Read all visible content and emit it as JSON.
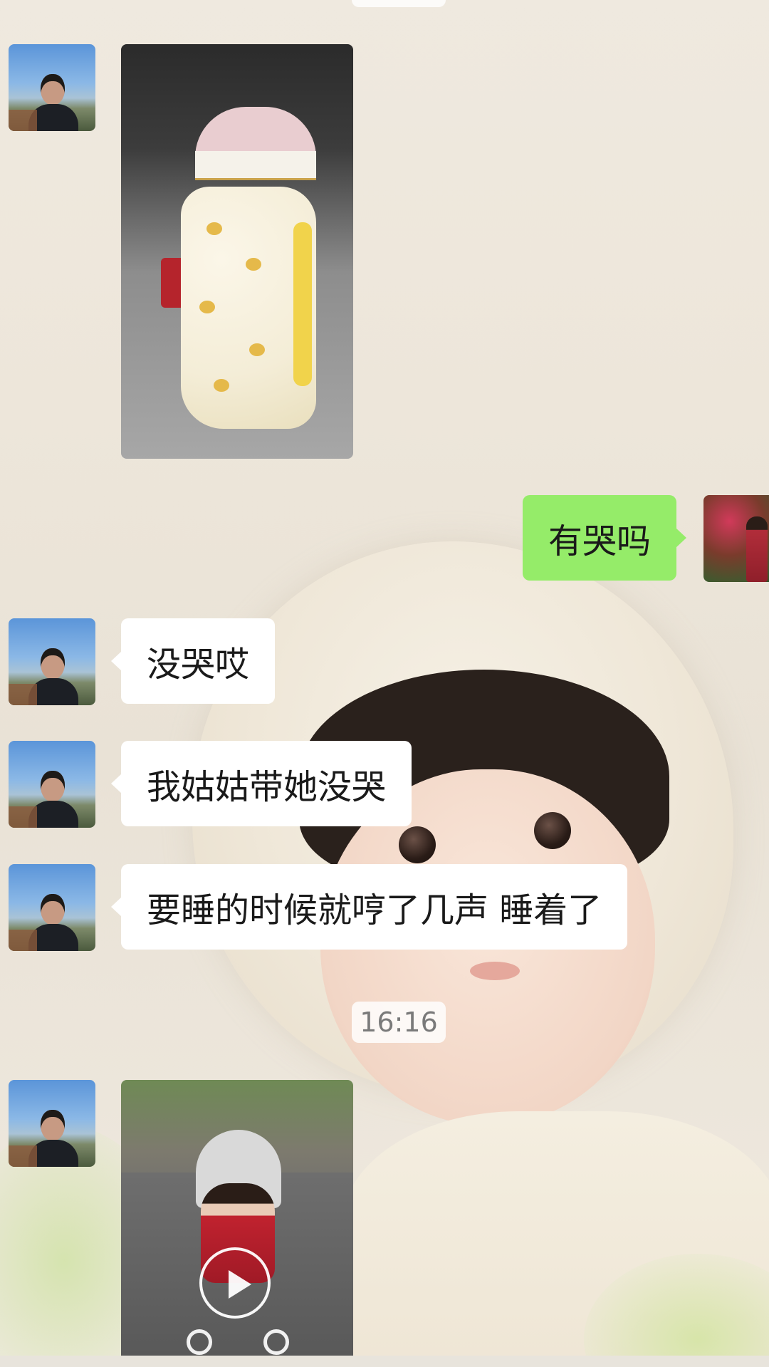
{
  "chat": {
    "timestamp": "16:16",
    "messages": [
      {
        "sender": "contact",
        "type": "image"
      },
      {
        "sender": "me",
        "type": "text",
        "text": "有哭吗"
      },
      {
        "sender": "contact",
        "type": "text",
        "text": "没哭哎"
      },
      {
        "sender": "contact",
        "type": "text",
        "text": "我姑姑带她没哭"
      },
      {
        "sender": "contact",
        "type": "text",
        "text": "要睡的时候就哼了几声 睡着了"
      },
      {
        "sender": "contact",
        "type": "video"
      }
    ]
  },
  "colors": {
    "outgoing_bubble": "#95ec69",
    "incoming_bubble": "#ffffff",
    "timestamp_text": "#7a7a7a"
  },
  "icons": {
    "video_play": "play-icon"
  }
}
